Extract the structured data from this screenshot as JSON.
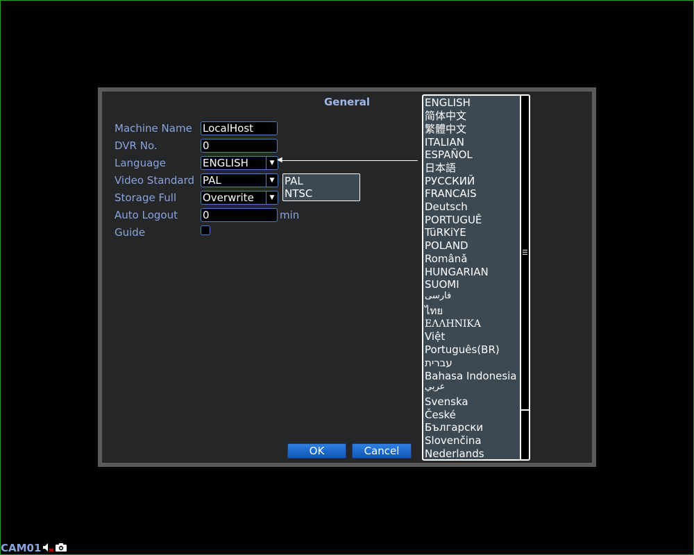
{
  "dialog": {
    "title": "General",
    "fields": {
      "machine_name": {
        "label": "Machine Name",
        "value": "LocalHost"
      },
      "dvr_no": {
        "label": "DVR No.",
        "value": "0"
      },
      "language": {
        "label": "Language",
        "value": "ENGLISH"
      },
      "video_standard": {
        "label": "Video Standard",
        "value": "PAL",
        "options": [
          "PAL",
          "NTSC"
        ]
      },
      "storage_full": {
        "label": "Storage Full",
        "value": "Overwrite"
      },
      "auto_logout": {
        "label": "Auto Logout",
        "value": "0",
        "unit": "min"
      },
      "guide": {
        "label": "Guide",
        "checked": false
      }
    },
    "buttons": {
      "ok": "OK",
      "cancel": "Cancel"
    }
  },
  "language_list": [
    "ENGLISH",
    "简体中文",
    "繁體中文",
    "ITALIAN",
    "ESPAÑOL",
    "日本語",
    "РУССКИЙ",
    "FRANCAIS",
    "Deutsch",
    "PORTUGUÊ",
    "TüRKiYE",
    "POLAND",
    "Românǎ",
    "HUNGARIAN",
    "SUOMI",
    "فارسی",
    "ไทย",
    "ΕΛΛΗΝΙΚΑ",
    "Việt",
    "Português(BR)",
    "עברית",
    "Bahasa Indonesia",
    "عربي",
    "Svenska",
    "České",
    "Български",
    "Slovenčina",
    "Nederlands"
  ],
  "status_bar": {
    "camera": "CAM01",
    "icons": [
      "mute-icon",
      "camera-icon"
    ]
  },
  "colors": {
    "accent_text": "#8aa4de",
    "field_border": "#4a7fc6",
    "button": "#1a6ad0",
    "list_bg": "#3d4952"
  }
}
